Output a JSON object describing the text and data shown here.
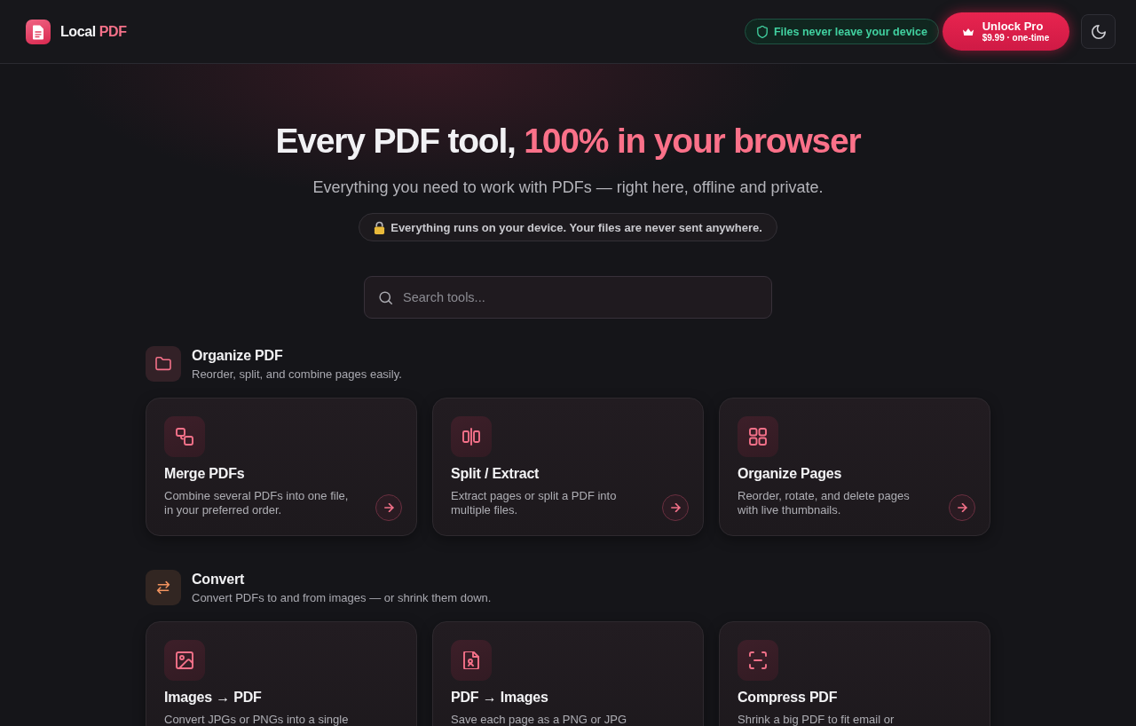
{
  "header": {
    "brand": {
      "name": "Local",
      "accent": "PDF"
    },
    "privacy_badge": "Files never leave your device",
    "unlock_button": {
      "label": "Unlock Pro",
      "price": "$9.99 · one-time"
    }
  },
  "hero": {
    "title": "Every PDF tool,",
    "title_highlight": "100% in your browser",
    "subtitle": "Everything you need to work with PDFs — right here, offline and private.",
    "notice": "Everything runs on your device. Your files are never sent anywhere."
  },
  "search": {
    "placeholder": "Search tools..."
  },
  "sections": [
    {
      "kind": "organize",
      "color": "#f47189",
      "title": "Organize PDF",
      "description": "Reorder, split, and combine pages easily.",
      "tools": [
        {
          "kind": "merge",
          "title": "Merge PDFs",
          "description": "Combine several PDFs into one file, in your preferred order.",
          "arrow_button": true
        },
        {
          "kind": "split",
          "title": "Split / Extract",
          "description": "Extract pages or split a PDF into multiple files.",
          "arrow_button": true
        },
        {
          "kind": "grid",
          "title": "Organize Pages",
          "description": "Reorder, rotate, and delete pages with live thumbnails.",
          "arrow_button": true
        }
      ]
    },
    {
      "kind": "convert",
      "color": "#f2935f",
      "title": "Convert",
      "description": "Convert PDFs to and from images — or shrink them down.",
      "tools": [
        {
          "kind": "image",
          "title": "Images → PDF",
          "description": "Convert JPGs or PNGs into a single",
          "arrow_button": false
        },
        {
          "kind": "file-image",
          "title": "PDF → Images",
          "description": "Save each page as a PNG or JPG",
          "arrow_button": false
        },
        {
          "kind": "scan",
          "title": "Compress PDF",
          "description": "Shrink a big PDF to fit email or",
          "arrow_button": false
        }
      ]
    }
  ]
}
